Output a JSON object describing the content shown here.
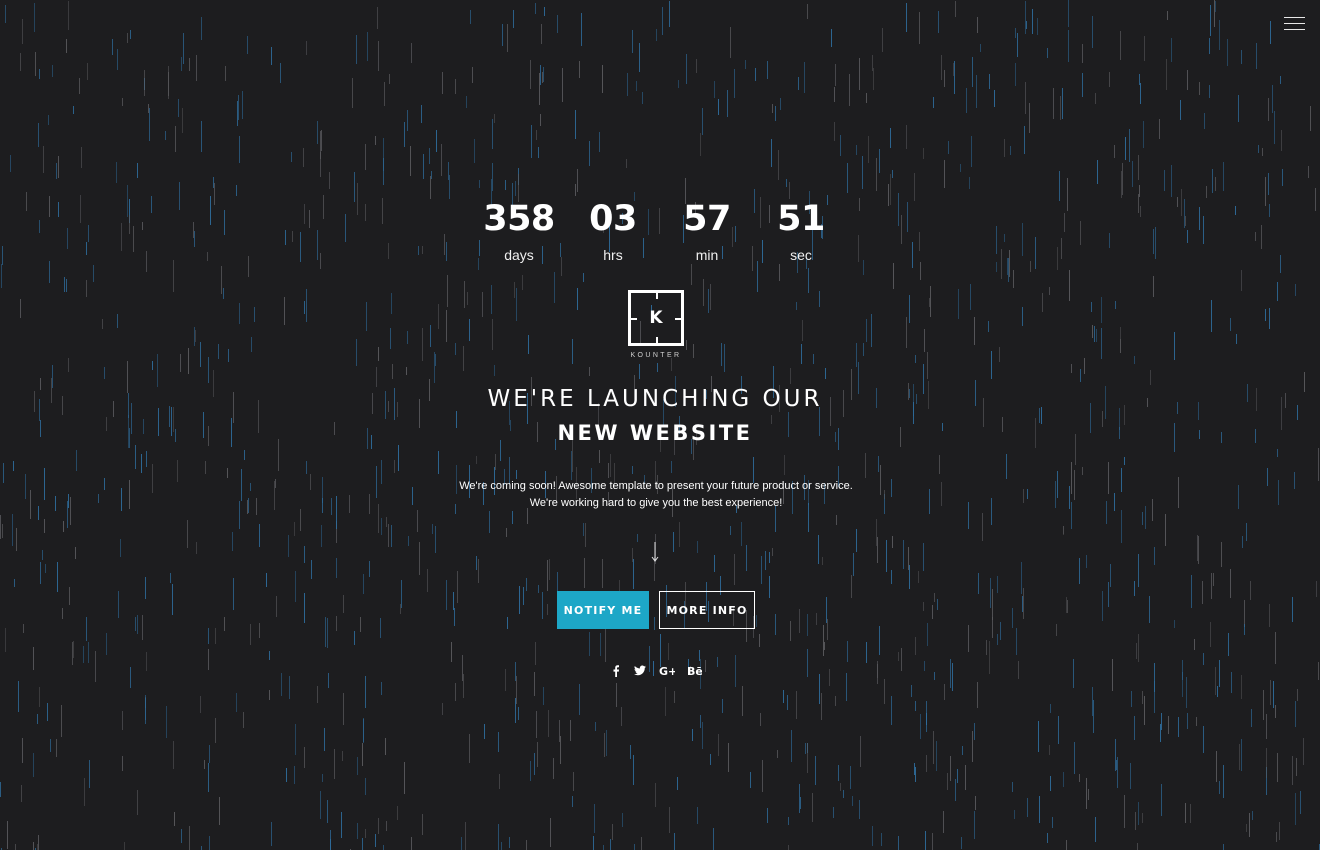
{
  "countdown": [
    {
      "value": "358",
      "label": "days"
    },
    {
      "value": "03",
      "label": "hrs"
    },
    {
      "value": "57",
      "label": "min"
    },
    {
      "value": "51",
      "label": "sec"
    }
  ],
  "logo": {
    "letter": "K",
    "name": "KOUNTER"
  },
  "headline": {
    "line1": "WE'RE LAUNCHING OUR",
    "line2": "NEW WEBSITE"
  },
  "description": {
    "line1": "We're coming soon! Awesome template to present your future product or service.",
    "line2": "We're working hard to give you the best experience!"
  },
  "buttons": {
    "notify": "NOTIFY ME",
    "more_info": "MORE INFO"
  },
  "social": [
    {
      "icon": "facebook-icon",
      "glyph": "f"
    },
    {
      "icon": "twitter-icon",
      "glyph": "🐦"
    },
    {
      "icon": "google-plus-icon",
      "glyph": "G+"
    },
    {
      "icon": "behance-icon",
      "glyph": "Bē"
    }
  ],
  "colors": {
    "background": "#1d1d1f",
    "accent": "#1da7c7",
    "rain_blue": "#2f6fa0",
    "rain_grey": "#5c5c60"
  },
  "icons": {
    "menu": "hamburger-menu-icon",
    "scroll": "arrow-down-icon"
  }
}
